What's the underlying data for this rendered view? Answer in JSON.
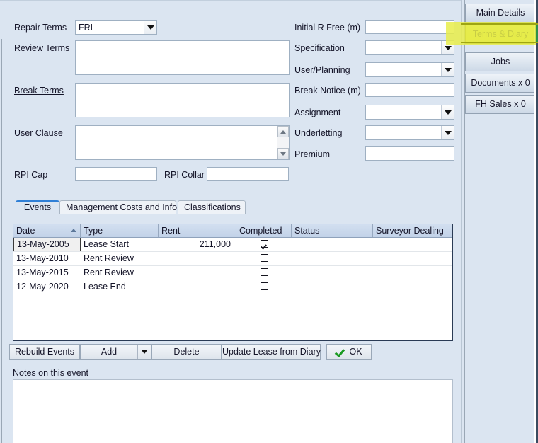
{
  "form": {
    "fields": [
      {
        "id": "repair_terms",
        "label": "Repair Terms",
        "value": "FRI",
        "kind": "combo",
        "underlined": false
      },
      {
        "id": "review_terms",
        "label": "Review Terms",
        "value": "",
        "kind": "textarea",
        "underlined": true
      },
      {
        "id": "break_terms",
        "label": "Break Terms",
        "value": "",
        "kind": "textarea",
        "underlined": true
      },
      {
        "id": "user_clause",
        "label": "User Clause",
        "value": "",
        "kind": "textarea-scroll",
        "underlined": true
      },
      {
        "id": "rpi_cap",
        "label": "RPI Cap",
        "value": "",
        "kind": "text",
        "underlined": false
      },
      {
        "id": "rpi_collar",
        "label": "RPI Collar",
        "value": "",
        "kind": "text",
        "underlined": false
      },
      {
        "id": "initial_r_free",
        "label": "Initial R Free (m)",
        "value": "",
        "kind": "text",
        "underlined": false
      },
      {
        "id": "specification",
        "label": "Specification",
        "value": "",
        "kind": "combo",
        "underlined": false
      },
      {
        "id": "user_planning",
        "label": "User/Planning",
        "value": "",
        "kind": "combo",
        "underlined": false
      },
      {
        "id": "break_notice",
        "label": "Break Notice (m)",
        "value": "",
        "kind": "text",
        "underlined": false
      },
      {
        "id": "assignment",
        "label": "Assignment",
        "value": "",
        "kind": "combo",
        "underlined": false
      },
      {
        "id": "underletting",
        "label": "Underletting",
        "value": "",
        "kind": "combo",
        "underlined": false
      },
      {
        "id": "premium",
        "label": "Premium",
        "value": "",
        "kind": "text",
        "underlined": false
      }
    ],
    "labels": {
      "repair_terms": "Repair Terms",
      "review_terms": "Review Terms",
      "break_terms": "Break Terms",
      "user_clause": "User Clause",
      "rpi_cap": "RPI Cap",
      "rpi_collar": "RPI Collar",
      "initial_r_free": "Initial R Free (m)",
      "specification": "Specification",
      "user_planning": "User/Planning",
      "break_notice": "Break Notice (m)",
      "assignment": "Assignment",
      "underletting": "Underletting",
      "premium": "Premium"
    },
    "values": {
      "repair_terms": "FRI",
      "review_terms": "",
      "break_terms": "",
      "user_clause": "",
      "rpi_cap": "",
      "rpi_collar": "",
      "initial_r_free": "",
      "specification": "",
      "user_planning": "",
      "break_notice": "",
      "assignment": "",
      "underletting": "",
      "premium": ""
    }
  },
  "inner_tabs": [
    {
      "label": "Events",
      "active": true
    },
    {
      "label": "Management Costs and Info",
      "active": false
    },
    {
      "label": "Classifications",
      "active": false
    }
  ],
  "grid": {
    "columns": [
      {
        "label": "Date",
        "sorted": "asc"
      },
      {
        "label": "Type",
        "sorted": ""
      },
      {
        "label": "Rent",
        "sorted": ""
      },
      {
        "label": "Completed",
        "sorted": ""
      },
      {
        "label": "Status",
        "sorted": ""
      },
      {
        "label": "Surveyor Dealing",
        "sorted": ""
      }
    ],
    "rows": [
      {
        "date": "13-May-2005",
        "type": "Lease Start",
        "rent": "211,000",
        "completed": true,
        "status": "",
        "surveyor": "",
        "selected": true
      },
      {
        "date": "13-May-2010",
        "type": "Rent Review",
        "rent": "",
        "completed": false,
        "status": "",
        "surveyor": "",
        "selected": false
      },
      {
        "date": "13-May-2015",
        "type": "Rent Review",
        "rent": "",
        "completed": false,
        "status": "",
        "surveyor": "",
        "selected": false
      },
      {
        "date": "12-May-2020",
        "type": "Lease End",
        "rent": "",
        "completed": false,
        "status": "",
        "surveyor": "",
        "selected": false
      }
    ]
  },
  "toolbar": {
    "rebuild_events": "Rebuild Events",
    "add": "Add",
    "delete": "Delete",
    "update_lease_from_diary": "Update Lease from Diary",
    "ok": "OK"
  },
  "notes": {
    "label": "Notes on this event",
    "value": ""
  },
  "side_tabs": [
    {
      "label": "Main Details",
      "selected": false
    },
    {
      "label": "Terms & Diary",
      "selected": true
    },
    {
      "label": "Jobs",
      "selected": false
    },
    {
      "label": "Documents x 0",
      "selected": false
    },
    {
      "label": "FH Sales x 0",
      "selected": false
    }
  ],
  "colors": {
    "panel_background": "#dbe5f1",
    "field_background": "#ffffff",
    "selected_tab": "#d6de3e",
    "highlight": "#e8ed4a",
    "grid_header": "#c9d7ea",
    "active_tab_accent": "#2f7fd6",
    "ok_tick": "#1a9a21"
  }
}
